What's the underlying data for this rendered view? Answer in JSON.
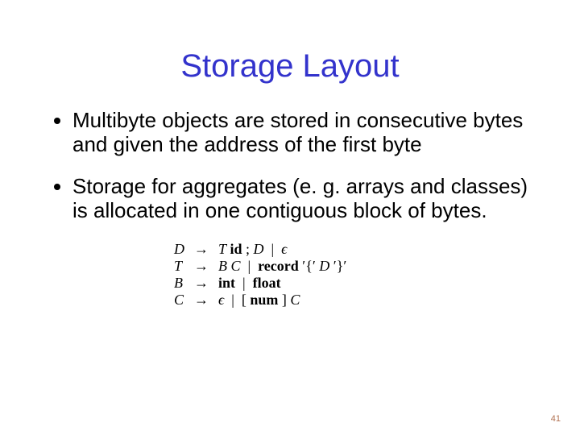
{
  "title": "Storage Layout",
  "bullets": [
    "Multibyte objects are stored in consecutive bytes and given the address of the first byte",
    "Storage for aggregates (e. g. arrays and classes) is allocated in one contiguous block of bytes."
  ],
  "grammar": {
    "rows": [
      {
        "lhs": "D",
        "rhs": "T id ; D  |  ε"
      },
      {
        "lhs": "T",
        "rhs": "B C  |  record '{' D '}'"
      },
      {
        "lhs": "B",
        "rhs": "int  |  float"
      },
      {
        "lhs": "C",
        "rhs": "ε  |  [ num ] C"
      }
    ]
  },
  "page_number": "41"
}
